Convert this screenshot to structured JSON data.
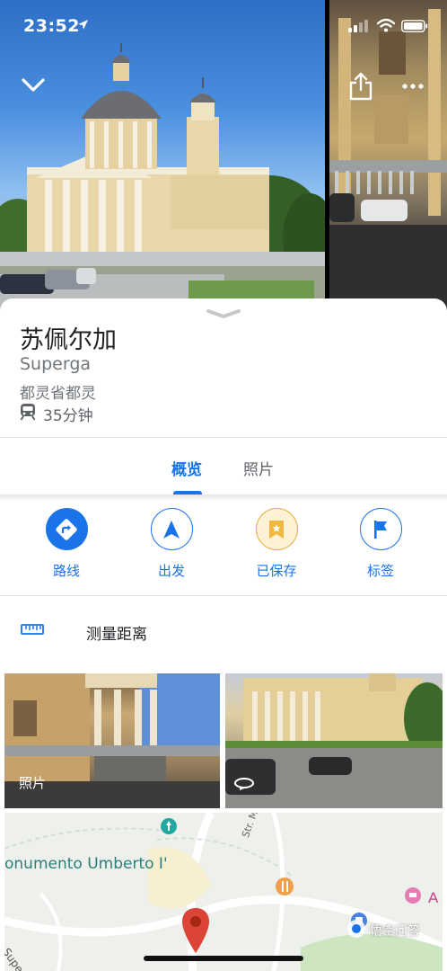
{
  "status_bar": {
    "time": "23:52"
  },
  "place": {
    "title": "苏佩尔加",
    "subtitle": "Superga",
    "region": "都灵省都灵",
    "transit_time": "35分钟"
  },
  "tabs": [
    {
      "label": "概览",
      "active": true
    },
    {
      "label": "照片",
      "active": false
    }
  ],
  "actions": [
    {
      "label": "路线",
      "icon": "directions-icon"
    },
    {
      "label": "出发",
      "icon": "navigation-arrow-icon"
    },
    {
      "label": "已保存",
      "icon": "saved-bookmark-icon"
    },
    {
      "label": "标签",
      "icon": "flag-icon"
    }
  ],
  "measure": {
    "label": "测量距离"
  },
  "photos": {
    "caption": "照片"
  },
  "map": {
    "poi_label": "onumento Umberto I'",
    "street_1": "Str. Mo",
    "street_2": "ale Superga"
  },
  "watermark": {
    "text": "悟空问答"
  },
  "colors": {
    "accent": "#1a73e8",
    "saved": "#e8a93b",
    "pin": "#db4437"
  }
}
